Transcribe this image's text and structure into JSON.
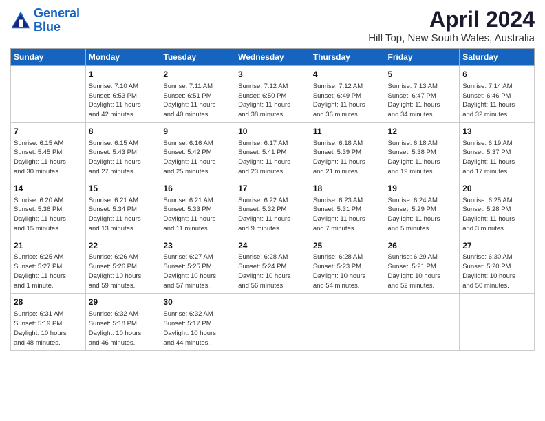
{
  "header": {
    "logo_line1": "General",
    "logo_line2": "Blue",
    "title": "April 2024",
    "subtitle": "Hill Top, New South Wales, Australia"
  },
  "days_of_week": [
    "Sunday",
    "Monday",
    "Tuesday",
    "Wednesday",
    "Thursday",
    "Friday",
    "Saturday"
  ],
  "weeks": [
    [
      {
        "num": "",
        "info": ""
      },
      {
        "num": "1",
        "info": "Sunrise: 7:10 AM\nSunset: 6:53 PM\nDaylight: 11 hours\nand 42 minutes."
      },
      {
        "num": "2",
        "info": "Sunrise: 7:11 AM\nSunset: 6:51 PM\nDaylight: 11 hours\nand 40 minutes."
      },
      {
        "num": "3",
        "info": "Sunrise: 7:12 AM\nSunset: 6:50 PM\nDaylight: 11 hours\nand 38 minutes."
      },
      {
        "num": "4",
        "info": "Sunrise: 7:12 AM\nSunset: 6:49 PM\nDaylight: 11 hours\nand 36 minutes."
      },
      {
        "num": "5",
        "info": "Sunrise: 7:13 AM\nSunset: 6:47 PM\nDaylight: 11 hours\nand 34 minutes."
      },
      {
        "num": "6",
        "info": "Sunrise: 7:14 AM\nSunset: 6:46 PM\nDaylight: 11 hours\nand 32 minutes."
      }
    ],
    [
      {
        "num": "7",
        "info": "Sunrise: 6:15 AM\nSunset: 5:45 PM\nDaylight: 11 hours\nand 30 minutes."
      },
      {
        "num": "8",
        "info": "Sunrise: 6:15 AM\nSunset: 5:43 PM\nDaylight: 11 hours\nand 27 minutes."
      },
      {
        "num": "9",
        "info": "Sunrise: 6:16 AM\nSunset: 5:42 PM\nDaylight: 11 hours\nand 25 minutes."
      },
      {
        "num": "10",
        "info": "Sunrise: 6:17 AM\nSunset: 5:41 PM\nDaylight: 11 hours\nand 23 minutes."
      },
      {
        "num": "11",
        "info": "Sunrise: 6:18 AM\nSunset: 5:39 PM\nDaylight: 11 hours\nand 21 minutes."
      },
      {
        "num": "12",
        "info": "Sunrise: 6:18 AM\nSunset: 5:38 PM\nDaylight: 11 hours\nand 19 minutes."
      },
      {
        "num": "13",
        "info": "Sunrise: 6:19 AM\nSunset: 5:37 PM\nDaylight: 11 hours\nand 17 minutes."
      }
    ],
    [
      {
        "num": "14",
        "info": "Sunrise: 6:20 AM\nSunset: 5:36 PM\nDaylight: 11 hours\nand 15 minutes."
      },
      {
        "num": "15",
        "info": "Sunrise: 6:21 AM\nSunset: 5:34 PM\nDaylight: 11 hours\nand 13 minutes."
      },
      {
        "num": "16",
        "info": "Sunrise: 6:21 AM\nSunset: 5:33 PM\nDaylight: 11 hours\nand 11 minutes."
      },
      {
        "num": "17",
        "info": "Sunrise: 6:22 AM\nSunset: 5:32 PM\nDaylight: 11 hours\nand 9 minutes."
      },
      {
        "num": "18",
        "info": "Sunrise: 6:23 AM\nSunset: 5:31 PM\nDaylight: 11 hours\nand 7 minutes."
      },
      {
        "num": "19",
        "info": "Sunrise: 6:24 AM\nSunset: 5:29 PM\nDaylight: 11 hours\nand 5 minutes."
      },
      {
        "num": "20",
        "info": "Sunrise: 6:25 AM\nSunset: 5:28 PM\nDaylight: 11 hours\nand 3 minutes."
      }
    ],
    [
      {
        "num": "21",
        "info": "Sunrise: 6:25 AM\nSunset: 5:27 PM\nDaylight: 11 hours\nand 1 minute."
      },
      {
        "num": "22",
        "info": "Sunrise: 6:26 AM\nSunset: 5:26 PM\nDaylight: 10 hours\nand 59 minutes."
      },
      {
        "num": "23",
        "info": "Sunrise: 6:27 AM\nSunset: 5:25 PM\nDaylight: 10 hours\nand 57 minutes."
      },
      {
        "num": "24",
        "info": "Sunrise: 6:28 AM\nSunset: 5:24 PM\nDaylight: 10 hours\nand 56 minutes."
      },
      {
        "num": "25",
        "info": "Sunrise: 6:28 AM\nSunset: 5:23 PM\nDaylight: 10 hours\nand 54 minutes."
      },
      {
        "num": "26",
        "info": "Sunrise: 6:29 AM\nSunset: 5:21 PM\nDaylight: 10 hours\nand 52 minutes."
      },
      {
        "num": "27",
        "info": "Sunrise: 6:30 AM\nSunset: 5:20 PM\nDaylight: 10 hours\nand 50 minutes."
      }
    ],
    [
      {
        "num": "28",
        "info": "Sunrise: 6:31 AM\nSunset: 5:19 PM\nDaylight: 10 hours\nand 48 minutes."
      },
      {
        "num": "29",
        "info": "Sunrise: 6:32 AM\nSunset: 5:18 PM\nDaylight: 10 hours\nand 46 minutes."
      },
      {
        "num": "30",
        "info": "Sunrise: 6:32 AM\nSunset: 5:17 PM\nDaylight: 10 hours\nand 44 minutes."
      },
      {
        "num": "",
        "info": ""
      },
      {
        "num": "",
        "info": ""
      },
      {
        "num": "",
        "info": ""
      },
      {
        "num": "",
        "info": ""
      }
    ]
  ]
}
